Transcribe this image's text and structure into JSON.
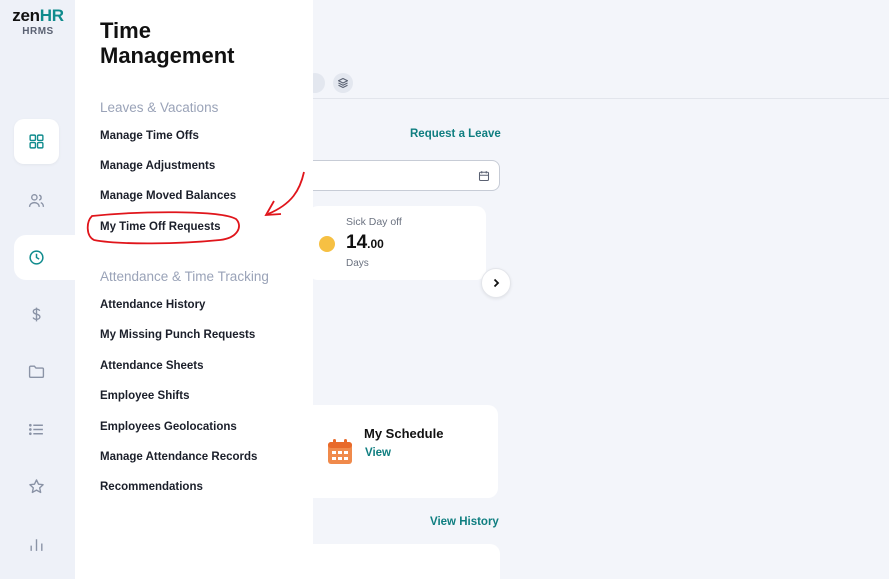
{
  "brand": {
    "logo_main": "zen",
    "logo_accent": "HR",
    "logo_sub": "HRMS"
  },
  "rail": {
    "items": [
      {
        "icon": "dashboard-icon"
      },
      {
        "icon": "people-icon"
      },
      {
        "icon": "clock-icon"
      },
      {
        "icon": "dollar-icon"
      },
      {
        "icon": "folder-icon"
      },
      {
        "icon": "list-icon"
      },
      {
        "icon": "star-icon"
      },
      {
        "icon": "bar-chart-icon"
      }
    ]
  },
  "menu": {
    "title_line1": "Time",
    "title_line2": "Management",
    "sections": [
      {
        "title": "Leaves & Vacations",
        "items": [
          "Manage Time Offs",
          "Manage Adjustments",
          "Manage Moved Balances",
          "My Time Off Requests"
        ]
      },
      {
        "title": "Attendance & Time Tracking",
        "items": [
          "Attendance History",
          "My Missing Punch Requests",
          "Attendance Sheets",
          "Employee Shifts",
          "Employees Geolocations",
          "Manage Attendance Records",
          "Recommendations"
        ]
      }
    ]
  },
  "main": {
    "request_leave_link": "Request a Leave",
    "balance": {
      "label": "Sick Day off",
      "value_int": "14",
      "value_dec": ".00",
      "unit": "Days"
    },
    "schedule": {
      "title": "My Schedule",
      "link": "View"
    },
    "view_history_link": "View History"
  },
  "colors": {
    "accent": "#0f7e80",
    "annotation": "#e0151b"
  }
}
